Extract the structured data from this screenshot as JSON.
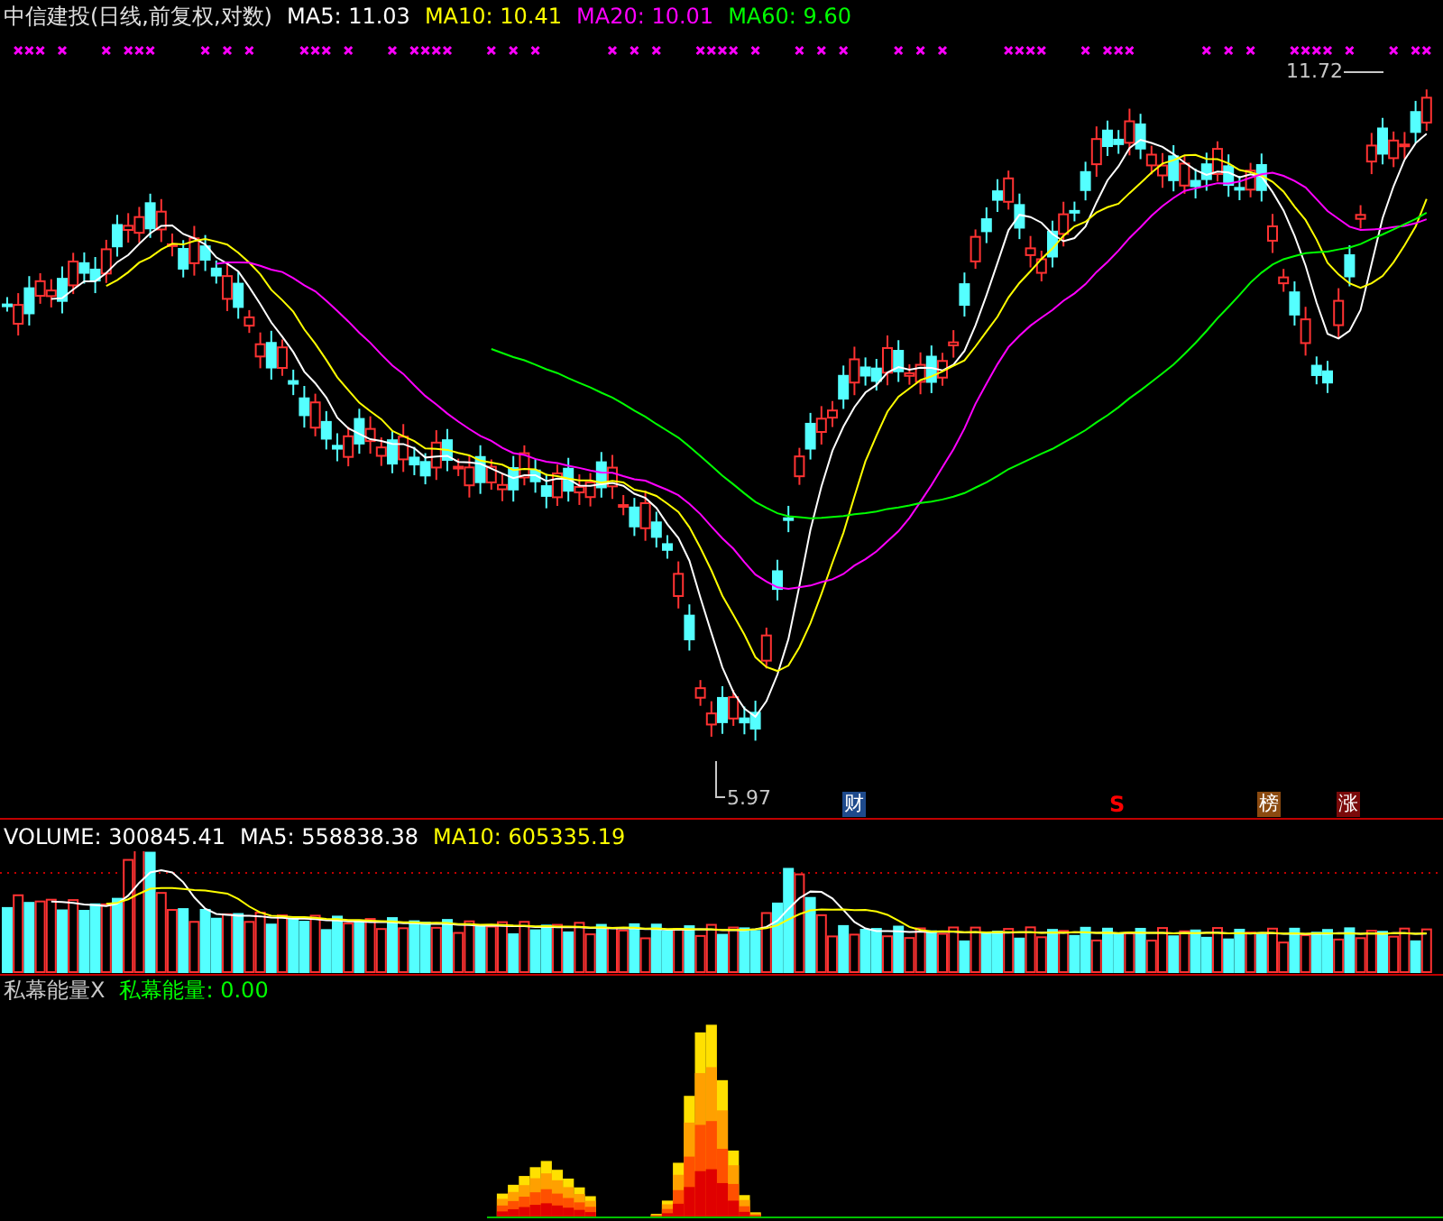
{
  "chart_header": {
    "title": "中信建投(日线,前复权,对数)",
    "indicators": [
      {
        "label": "MA5:",
        "value": "11.03",
        "color": "#ffffff"
      },
      {
        "label": "MA10:",
        "value": "10.41",
        "color": "#ffff00"
      },
      {
        "label": "MA20:",
        "value": "10.01",
        "color": "#ff00ff"
      },
      {
        "label": "MA60:",
        "value": "9.60",
        "color": "#00ff00"
      }
    ]
  },
  "price_annotations": [
    {
      "text": "11.72"
    },
    {
      "text": "5.97"
    }
  ],
  "event_markers": [
    {
      "text": "财",
      "kind": "badge",
      "color": "#1e4a8c"
    },
    {
      "text": "S",
      "kind": "arrow",
      "color": "#ff0000"
    },
    {
      "text": "榜",
      "kind": "badge",
      "color": "#8b4a10"
    },
    {
      "text": "涨",
      "kind": "badge",
      "color": "#7a0a0a"
    }
  ],
  "volume_header": {
    "indicators": [
      {
        "label": "VOLUME:",
        "value": "300845.41",
        "color": "#ffffff"
      },
      {
        "label": "MA5:",
        "value": "558838.38",
        "color": "#ffffff"
      },
      {
        "label": "MA10:",
        "value": "605335.19",
        "color": "#ffff00"
      }
    ]
  },
  "energy_header": {
    "name": "私幕能量X",
    "indicators": [
      {
        "label": "私幕能量:",
        "value": "0.00",
        "color": "#00ff00"
      }
    ]
  }
}
